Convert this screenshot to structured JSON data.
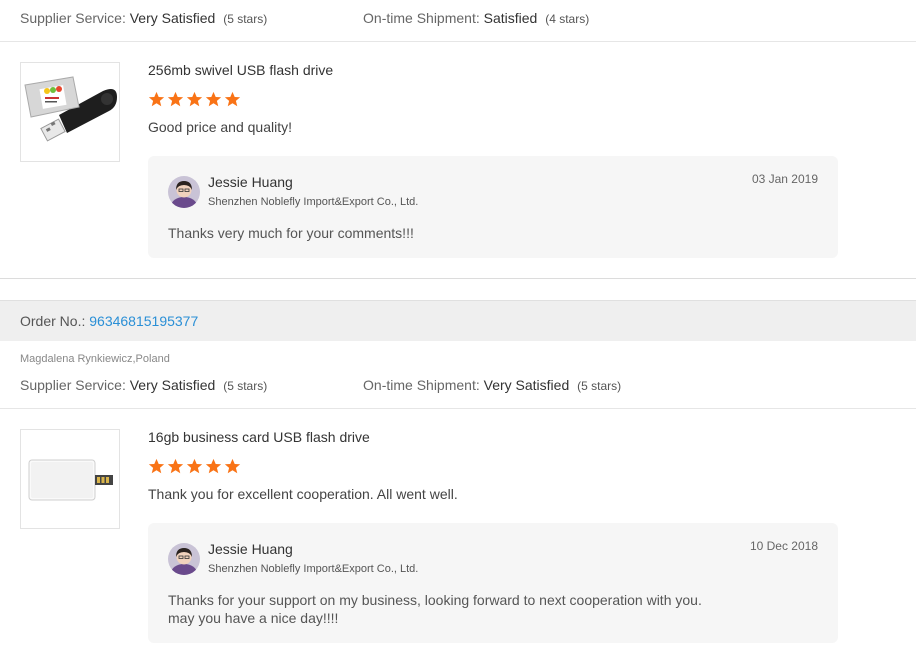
{
  "review1": {
    "supplier_service_label": "Supplier Service:",
    "supplier_service_value": "Very Satisfied",
    "supplier_service_stars": "(5 stars)",
    "shipment_label": "On-time Shipment:",
    "shipment_value": "Satisfied",
    "shipment_stars": "(4 stars)",
    "product_title": "256mb swivel USB flash drive",
    "product_icon": "usb-swivel-flash-drive-icon",
    "rating": 5,
    "comment": "Good price and quality!",
    "reply": {
      "name": "Jessie Huang",
      "company": "Shenzhen Noblefly Import&Export Co., Ltd.",
      "date": "03 Jan 2019",
      "text_lines": [
        "Thanks very much for your comments!!!"
      ]
    }
  },
  "order": {
    "label": "Order No.:",
    "number": "96346815195377"
  },
  "review2": {
    "buyer": "Magdalena Rynkiewicz,Poland",
    "supplier_service_label": "Supplier Service:",
    "supplier_service_value": "Very Satisfied",
    "supplier_service_stars": "(5 stars)",
    "shipment_label": "On-time Shipment:",
    "shipment_value": "Very Satisfied",
    "shipment_stars": "(5 stars)",
    "product_title": "16gb business card USB flash drive",
    "product_icon": "card-usb-flash-drive-icon",
    "rating": 5,
    "comment": "Thank you for excellent cooperation. All went well.",
    "reply": {
      "name": "Jessie Huang",
      "company": "Shenzhen Noblefly Import&Export Co., Ltd.",
      "date": "10 Dec 2018",
      "text_lines": [
        "Thanks for your support on my business, looking forward to next cooperation with you.",
        "may you have a nice day!!!!"
      ]
    }
  },
  "colors": {
    "star": "#f97316",
    "link": "#2a8fd6"
  }
}
